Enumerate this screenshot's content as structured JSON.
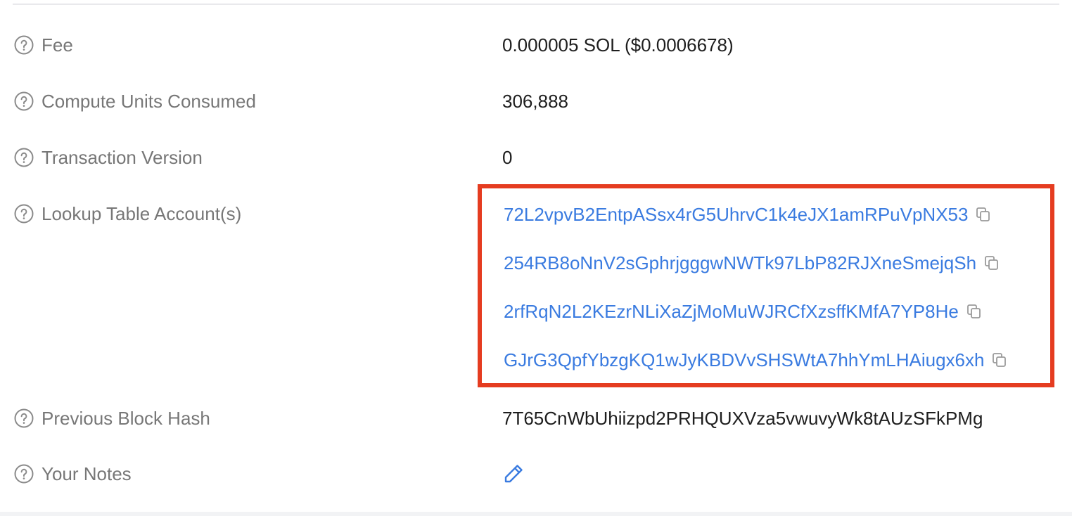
{
  "rows": {
    "fee": {
      "label": "Fee",
      "value": "0.000005 SOL ($0.0006678)"
    },
    "compute_units": {
      "label": "Compute Units Consumed",
      "value": "306,888"
    },
    "tx_version": {
      "label": "Transaction Version",
      "value": "0"
    },
    "lookup_tables": {
      "label": "Lookup Table Account(s)",
      "accounts": [
        "72L2vpvB2EntpASsx4rG5UhrvC1k4eJX1amRPuVpNX53",
        "254RB8oNnV2sGphrjgggwNWTk97LbP82RJXneSmejqSh",
        "2rfRqN2L2KEzrNLiXaZjMoMuWJRCfXzsffKMfA7YP8He",
        "GJrG3QpfYbzgKQ1wJyKBDVvSHSWtA7hhYmLHAiugx6xh"
      ]
    },
    "prev_block_hash": {
      "label": "Previous Block Hash",
      "value": "7T65CnWbUhiizpd2PRHQUXVza5vwuvyWk8tAUzSFkPMg"
    },
    "notes": {
      "label": "Your Notes"
    }
  },
  "icons": {
    "help": "question-circle-icon",
    "copy": "copy-icon",
    "edit": "pencil-icon"
  },
  "colors": {
    "label": "#777777",
    "value": "#1e1e1e",
    "link": "#3a7be0",
    "highlight_border": "#e53c20"
  }
}
